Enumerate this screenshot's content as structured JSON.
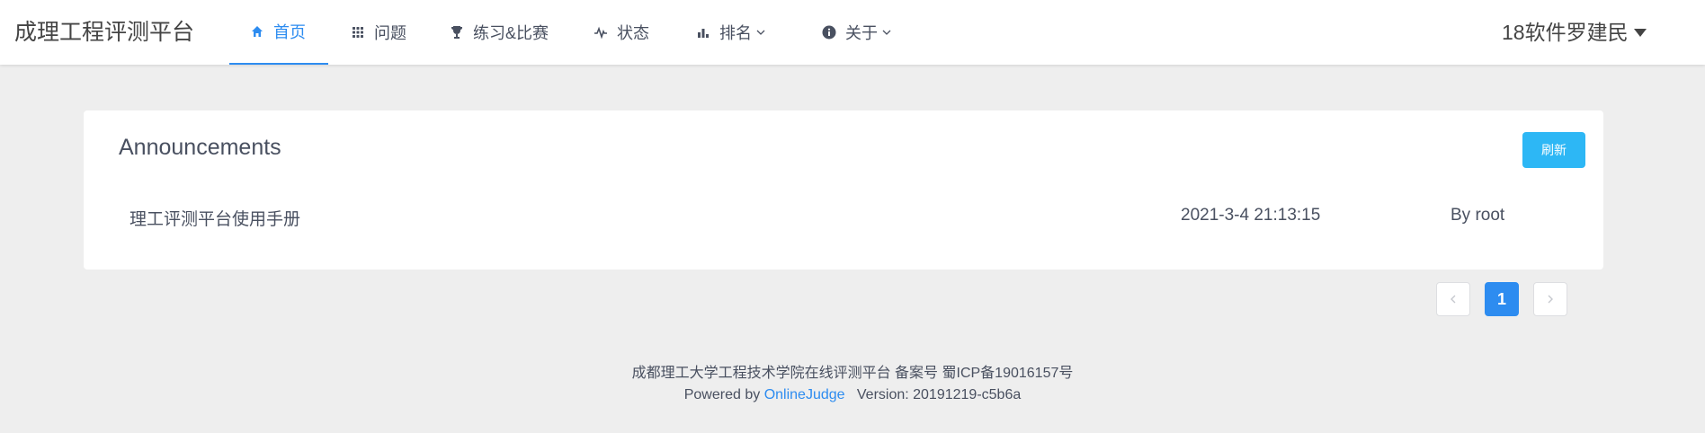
{
  "app": {
    "logo": "成理工程评测平台"
  },
  "nav": {
    "items": [
      {
        "label": "首页",
        "icon": "home-icon",
        "active": true
      },
      {
        "label": "问题",
        "icon": "grid-icon"
      },
      {
        "label": "练习&比赛",
        "icon": "trophy-icon"
      },
      {
        "label": "状态",
        "icon": "pulse-icon"
      },
      {
        "label": "排名",
        "icon": "bar-chart-icon",
        "dropdown": true
      },
      {
        "label": "关于",
        "icon": "info-icon",
        "dropdown": true
      }
    ],
    "user": "18软件罗建民"
  },
  "announcements": {
    "title": "Announcements",
    "refresh_label": "刷新",
    "items": [
      {
        "title": "理工评测平台使用手册",
        "date": "2021-3-4 21:13:15",
        "author": "By root"
      }
    ]
  },
  "pagination": {
    "current": "1"
  },
  "footer": {
    "line1": "成都理工大学工程技术学院在线评测平台 备案号 蜀ICP备19016157号",
    "powered_by": "Powered by",
    "oj_link": "OnlineJudge",
    "version": "Version: 20191219-c5b6a"
  },
  "colors": {
    "accent": "#2d8cf0",
    "refresh": "#2db7f5",
    "background": "#eeeeee"
  }
}
